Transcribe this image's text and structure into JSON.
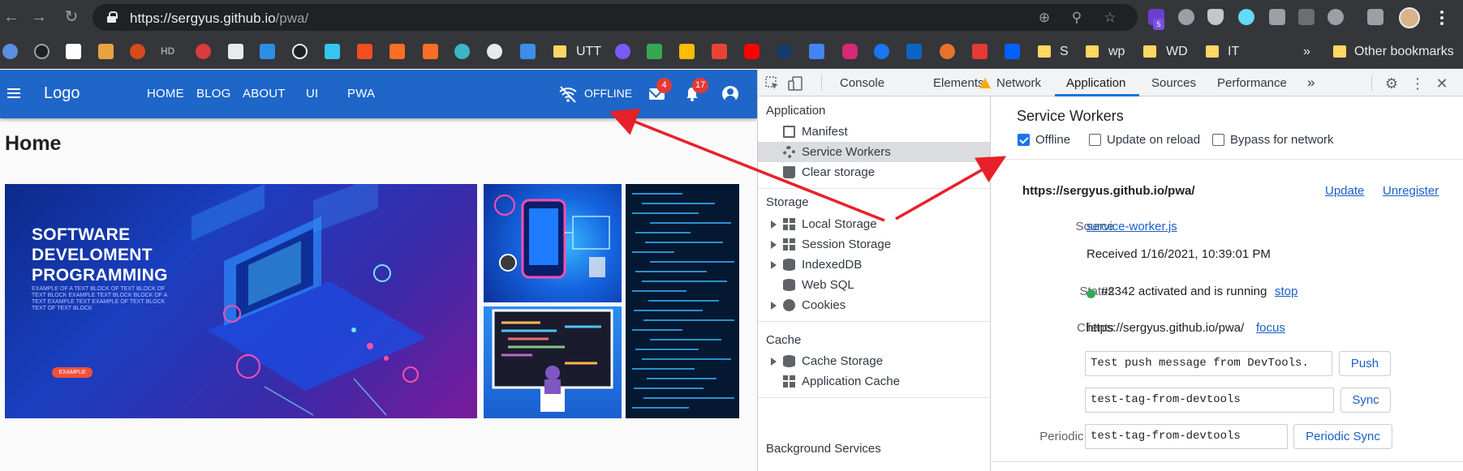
{
  "browser": {
    "url_host": "https://sergyus.github.io",
    "url_path": "/pwa/",
    "extension_badge": "5",
    "bookmarks": [
      {
        "label": "UTT"
      },
      {
        "label": "S"
      },
      {
        "label": "wp"
      },
      {
        "label": "WD"
      },
      {
        "label": "IT"
      }
    ],
    "overflow_label": "»",
    "other_bookmarks": "Other bookmarks",
    "favicon_labels": {
      "hd": "HD"
    }
  },
  "app": {
    "logo": "Logo",
    "nav": [
      "HOME",
      "BLOG",
      "ABOUT",
      "UI",
      "PWA"
    ],
    "offline_label": "OFFLINE",
    "mail_count": "4",
    "notification_count": "17",
    "page_title": "Home",
    "hero": {
      "headline_1": "SOFTWARE",
      "headline_2": "DEVELOMENT",
      "headline_3": "PROGRAMMING",
      "small_text": "EXAMPLE OF A TEXT BLOCK OF TEXT BLOCK OF TEXT BLOCK EXAMPLE TEXT BLOCK BLOCK OF A TEXT EXAMPLE TEXT EXAMPLE OF TEXT BLOCK TEXT OF TEXT BLOCK",
      "button": "EXAMPLE"
    }
  },
  "devtools": {
    "tabs": [
      "Console",
      "Elements",
      "Network",
      "Application",
      "Sources",
      "Performance"
    ],
    "more_tabs": "»",
    "active_tab": "Application",
    "sidebar": {
      "application_header": "Application",
      "application_items": [
        "Manifest",
        "Service Workers",
        "Clear storage"
      ],
      "selected_item": "Service Workers",
      "storage_header": "Storage",
      "storage_items": [
        "Local Storage",
        "Session Storage",
        "IndexedDB",
        "Web SQL",
        "Cookies"
      ],
      "cache_header": "Cache",
      "cache_items": [
        "Cache Storage",
        "Application Cache"
      ],
      "background_header": "Background Services"
    },
    "service_workers": {
      "title": "Service Workers",
      "offline_label": "Offline",
      "offline_checked": true,
      "update_on_reload_label": "Update on reload",
      "update_on_reload_checked": false,
      "bypass_label": "Bypass for network",
      "bypass_checked": false,
      "scope": "https://sergyus.github.io/pwa/",
      "update_link": "Update",
      "unregister_link": "Unregister",
      "source_label": "Source",
      "source_link": "service-worker.js",
      "received": "Received 1/16/2021, 10:39:01 PM",
      "status_label": "Status",
      "status_text": "#2342 activated and is running",
      "stop_link": "stop",
      "clients_label": "Clients",
      "clients_value": "https://sergyus.github.io/pwa/",
      "focus_link": "focus",
      "push_label": "Push",
      "push_value": "Test push message from DevTools.",
      "push_button": "Push",
      "sync_label": "Sync",
      "sync_value": "test-tag-from-devtools",
      "sync_button": "Sync",
      "periodic_sync_label": "Periodic Sync",
      "periodic_sync_value": "test-tag-from-devtools",
      "periodic_sync_button": "Periodic Sync"
    }
  },
  "colors": {
    "appbar": "#1e66c8",
    "badge": "#e53935",
    "devtools_accent": "#1a73e8",
    "annotation_arrow": "#e8202a",
    "status_running": "#34a853"
  }
}
